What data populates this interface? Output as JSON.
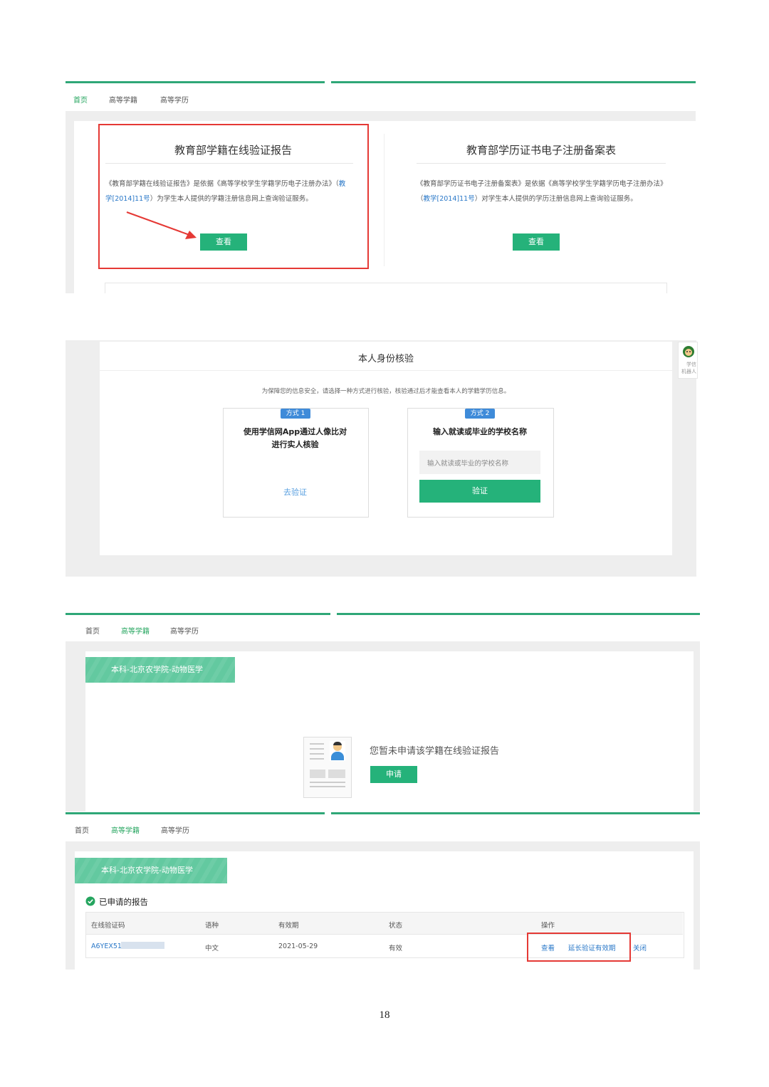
{
  "nav": {
    "home": "首页",
    "student": "高等学籍",
    "degree": "高等学历"
  },
  "section1": {
    "card1": {
      "title": "教育部学籍在线验证报告",
      "desc_pre": "《教育部学籍在线验证报告》是依据《高等学校学生学籍学历电子注册办法》（",
      "desc_link": "教学[2014]11号",
      "desc_post": "）为学生本人提供的学籍注册信息网上查询验证服务。",
      "button": "查看"
    },
    "card2": {
      "title": "教育部学历证书电子注册备案表",
      "desc_pre": "《教育部学历证书电子注册备案表》是依据《高等学校学生学籍学历电子注册办法》（",
      "desc_link": "教学[2014]11号",
      "desc_post": "）对学生本人提供的学历注册信息网上查询验证服务。",
      "button": "查看"
    }
  },
  "section2": {
    "title": "本人身份核验",
    "note": "为保障您的信息安全，请选择一种方式进行核验，核验通过后才能查看本人的学籍学历信息。",
    "side_label_1": "学信",
    "side_label_2": "机器人",
    "method1": {
      "tag": "方式 1",
      "title_1": "使用学信网App通过人像比对",
      "title_2": "进行实人核验",
      "link": "去验证"
    },
    "method2": {
      "tag": "方式 2",
      "title": "输入就读或毕业的学校名称",
      "placeholder": "输入就读或毕业的学校名称",
      "button": "验证"
    }
  },
  "section3": {
    "banner": "本科-北京农学院-动物医学",
    "message": "您暂未申请该学籍在线验证报告",
    "button": "申请"
  },
  "section4": {
    "banner": "本科-北京农学院-动物医学",
    "heading": "已申请的报告",
    "columns": [
      "在线验证码",
      "语种",
      "有效期",
      "状态",
      "操作"
    ],
    "row": {
      "code": "A6YEX51",
      "lang": "中文",
      "expiry": "2021-05-29",
      "status": "有效",
      "op_view": "查看",
      "op_extend": "延长验证有效期",
      "op_close": "关闭"
    }
  },
  "page_number": "18",
  "colors": {
    "accent": "#25b27a",
    "highlight": "#e53935",
    "link": "#2a78c8",
    "tag": "#3f8bd9"
  }
}
